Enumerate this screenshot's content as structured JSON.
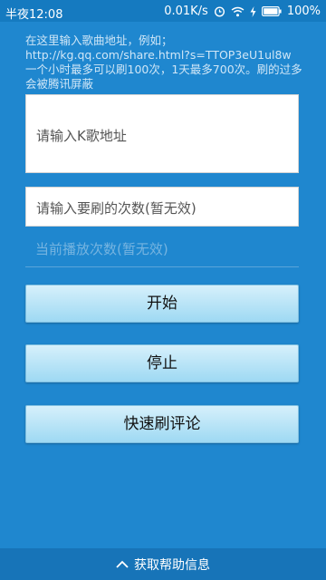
{
  "status": {
    "time": "半夜12:08",
    "network_speed": "0.01K/s",
    "battery": "100%",
    "icons": [
      "alarm-icon",
      "wifi-icon",
      "charging-icon",
      "battery-icon"
    ]
  },
  "intro": {
    "text": "在这里输入歌曲地址，例如；http://kg.qq.com/share.html?s=TTOP3eU1ul8w　　一个小时最多可以刷100次，1天最多700次。刷的过多会被腾讯屏蔽"
  },
  "form": {
    "url_placeholder": "请输入K歌地址",
    "count_placeholder": "请输入要刷的次数(暂无效)",
    "play_count_label": "当前播放次数(暂无效)"
  },
  "buttons": {
    "start": "开始",
    "stop": "停止",
    "comment": "快速刷评论"
  },
  "footer": {
    "label": "获取帮助信息",
    "icon": "chevron-up-icon"
  }
}
